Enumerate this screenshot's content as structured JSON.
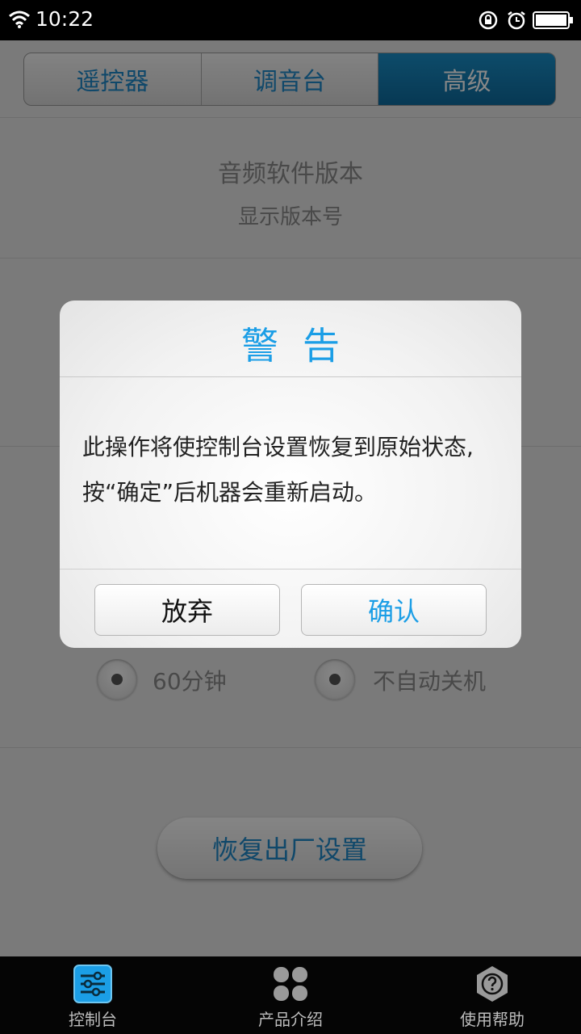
{
  "status": {
    "time": "10:22"
  },
  "tabs": [
    {
      "label": "遥控器"
    },
    {
      "label": "调音台"
    },
    {
      "label": "高级",
      "selected": true
    }
  ],
  "version": {
    "title": "音频软件版本",
    "subtitle": "显示版本号"
  },
  "auto_off": {
    "options": [
      {
        "label": "60分钟"
      },
      {
        "label": "不自动关机"
      }
    ]
  },
  "factory_reset": {
    "label": "恢复出厂设置"
  },
  "dialog": {
    "title": "警告",
    "message_line1": "此操作将使控制台设置恢复到原始状态,",
    "message_line2": "按“确定”后机器会重新启动。",
    "cancel_label": "放弃",
    "confirm_label": "确认"
  },
  "bottom_nav": [
    {
      "label": "控制台",
      "icon": "sliders-icon",
      "active": true
    },
    {
      "label": "产品介绍",
      "icon": "four-leaf-icon"
    },
    {
      "label": "使用帮助",
      "icon": "help-hexagon-icon"
    }
  ],
  "colors": {
    "accent": "#1b9ee6",
    "tab_selected": "#0e6b9e"
  }
}
